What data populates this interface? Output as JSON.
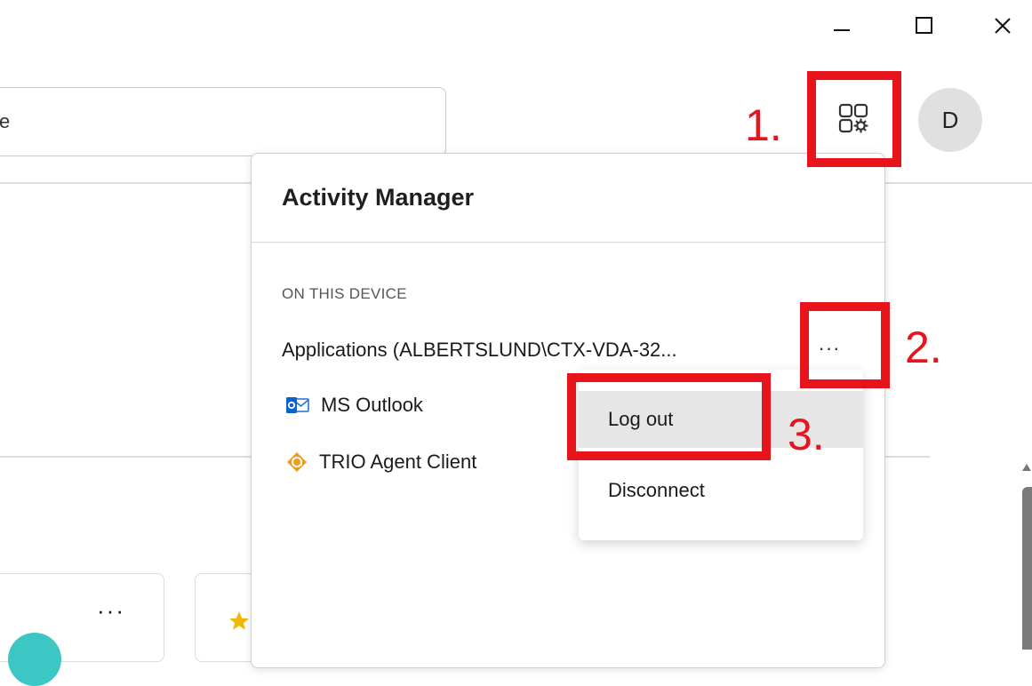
{
  "window": {
    "minimize_icon": "minimize-icon",
    "maximize_icon": "maximize-icon",
    "close_icon": "close-icon"
  },
  "search": {
    "value": "e",
    "placeholder": ""
  },
  "header": {
    "activity_manager_button_icon": "apps-gear-icon",
    "avatar_initial": "D"
  },
  "activity_manager": {
    "title": "Activity Manager",
    "section_label": "ON THIS DEVICE",
    "session": {
      "label": "Applications (ALBERTSLUND\\CTX-VDA-32...",
      "more_label": "···"
    },
    "apps": [
      {
        "name": "MS Outlook",
        "icon": "outlook-icon"
      },
      {
        "name": "TRIO Agent Client",
        "icon": "trio-agent-icon"
      }
    ]
  },
  "session_menu": {
    "items": [
      {
        "label": "Log out"
      },
      {
        "label": "Disconnect"
      }
    ]
  },
  "background": {
    "card_more_label": "···"
  },
  "annotations": {
    "step1": "1.",
    "step2": "2.",
    "step3": "3.",
    "color": "#e8141c"
  }
}
